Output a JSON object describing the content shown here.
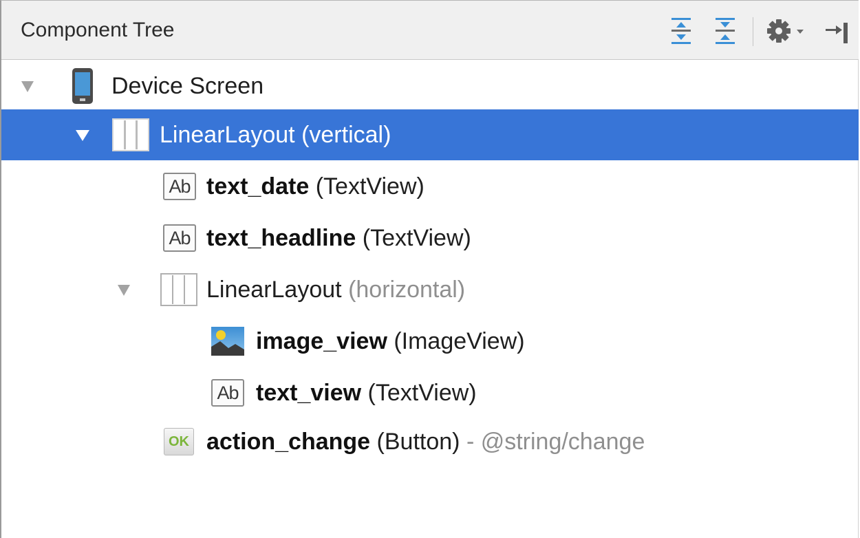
{
  "panel": {
    "title": "Component Tree",
    "toolbar": [
      {
        "icon": "expand-all-icon"
      },
      {
        "icon": "collapse-all-icon"
      },
      {
        "icon": "gear-icon"
      },
      {
        "icon": "hide-panel-icon"
      }
    ]
  },
  "tree": [
    {
      "name": "Device Screen",
      "type": "",
      "extra": "",
      "icon": "device-icon",
      "expanded": true,
      "selected": false
    },
    {
      "name": "LinearLayout",
      "type": "(vertical)",
      "extra": "",
      "icon": "linear-layout-icon",
      "expanded": true,
      "selected": true
    },
    {
      "name": "text_date",
      "type": "(TextView)",
      "extra": "",
      "icon": "textview-icon",
      "icon_text": "Ab"
    },
    {
      "name": "text_headline",
      "type": "(TextView)",
      "extra": "",
      "icon": "textview-icon",
      "icon_text": "Ab"
    },
    {
      "name": "LinearLayout",
      "type": "(horizontal)",
      "extra": "",
      "icon": "linear-layout-icon",
      "expanded": true,
      "selected": false
    },
    {
      "name": "image_view",
      "type": "(ImageView)",
      "extra": "",
      "icon": "imageview-icon"
    },
    {
      "name": "text_view",
      "type": "(TextView)",
      "extra": "",
      "icon": "textview-icon",
      "icon_text": "Ab"
    },
    {
      "name": "action_change",
      "type": "(Button)",
      "extra": "- @string/change",
      "icon": "button-icon",
      "icon_text": "OK"
    }
  ],
  "colors": {
    "selection": "#3875d7",
    "toolbar_accent": "#3a8fd6",
    "dim_text": "#8f8f8f"
  }
}
